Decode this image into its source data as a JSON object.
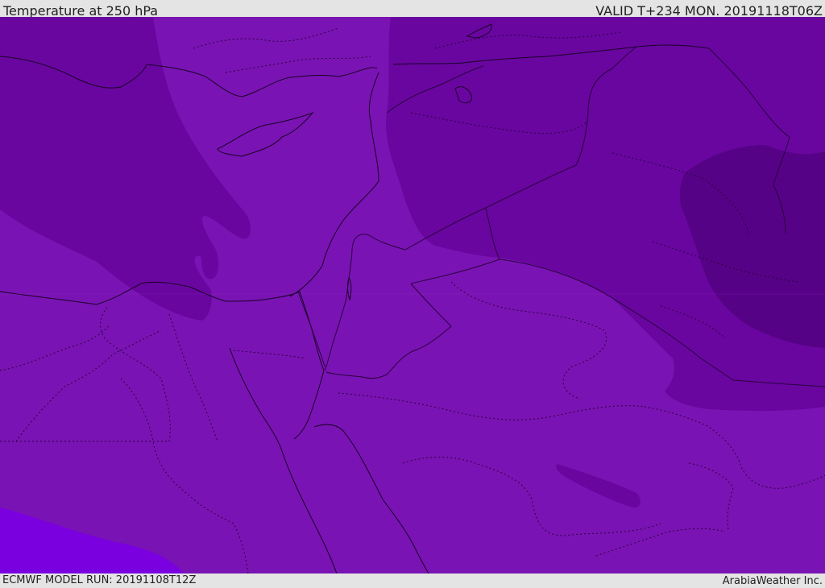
{
  "header": {
    "title": "Temperature at 250 hPa",
    "valid": "VALID T+234 MON. 20191118T06Z"
  },
  "footer": {
    "model_run": "ECMWF MODEL RUN: 20191108T12Z",
    "credit": "ArabiaWeather Inc."
  },
  "map": {
    "colors": {
      "base": "#7a13b3",
      "darker": "#69069f",
      "darkest": "#560286",
      "bright": "#7a00e0",
      "coast": "#1a0028",
      "border": "#2a0040"
    }
  }
}
